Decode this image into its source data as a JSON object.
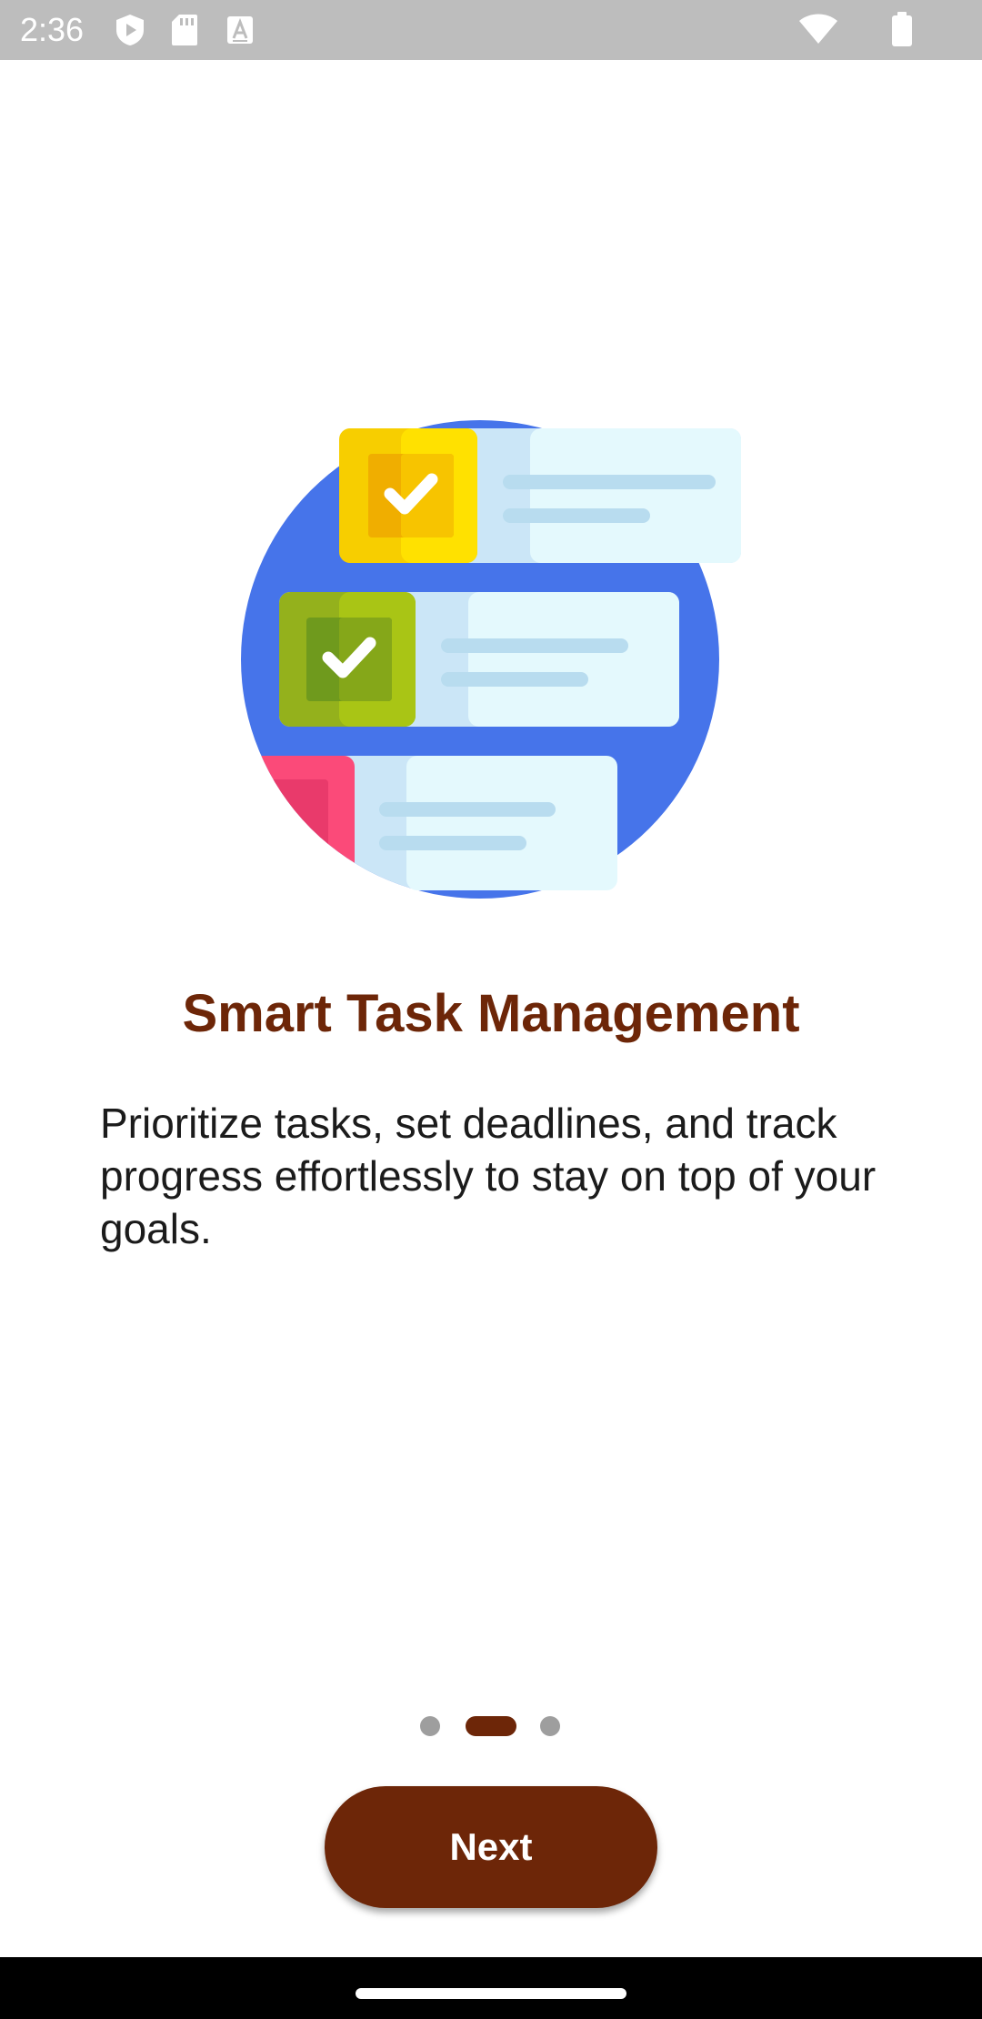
{
  "status_bar": {
    "time": "2:36",
    "left_icons": [
      "play-protect-icon",
      "sd-card-icon",
      "text-a-icon"
    ],
    "right_icons": [
      "wifi-icon",
      "battery-icon"
    ]
  },
  "onboarding": {
    "illustration": "task-checklist-illustration",
    "title": "Smart Task Management",
    "description": "Prioritize tasks, set deadlines, and track progress effortlessly to stay on top of your goals.",
    "current_page": 2,
    "total_pages": 3,
    "next_label": "Next"
  },
  "colors": {
    "accent": "#6d2608",
    "status_bar": "#bdbdbd",
    "inactive_dot": "#9e9e9e"
  }
}
